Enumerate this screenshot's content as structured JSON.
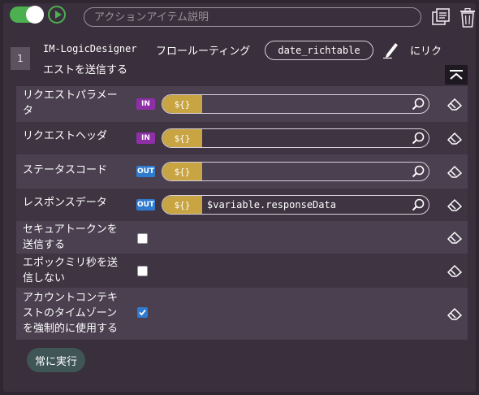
{
  "top": {
    "description_placeholder": "アクションアイテム説明",
    "enabled": true
  },
  "step": {
    "number": "1",
    "designer": "IM-LogicDesigner",
    "routing": "フロールーティング",
    "chip": "date_richtable",
    "suffix_line1": "にリク",
    "suffix_line2": "エストを送信する"
  },
  "params": [
    {
      "label_line1": "リクエストパラメー",
      "label_line2": "タ",
      "direction": "IN",
      "var": "${}",
      "value": ""
    },
    {
      "label_line1": "リクエストヘッダ",
      "label_line2": "",
      "direction": "IN",
      "var": "${}",
      "value": ""
    },
    {
      "label_line1": "ステータスコード",
      "label_line2": "",
      "direction": "OUT",
      "var": "${}",
      "value": ""
    },
    {
      "label_line1": "レスポンスデータ",
      "label_line2": "",
      "direction": "OUT",
      "var": "${}",
      "value": "$variable.responseData"
    }
  ],
  "options": [
    {
      "label_line1": "セキュアトークンを",
      "label_line2": "送信する",
      "label_line3": "",
      "checked": false
    },
    {
      "label_line1": "エポックミリ秒を送",
      "label_line2": "信しない",
      "label_line3": "",
      "checked": false
    },
    {
      "label_line1": "アカウントコンテキ",
      "label_line2": "ストのタイムゾーン",
      "label_line3": "を強制的に使用する",
      "checked": true
    }
  ],
  "run_button": "常に実行",
  "colors": {
    "toggle_on": "#4caf50",
    "in_badge": "#8e2fa8",
    "out_badge": "#2f7bd0",
    "variable": "#c9a442"
  }
}
